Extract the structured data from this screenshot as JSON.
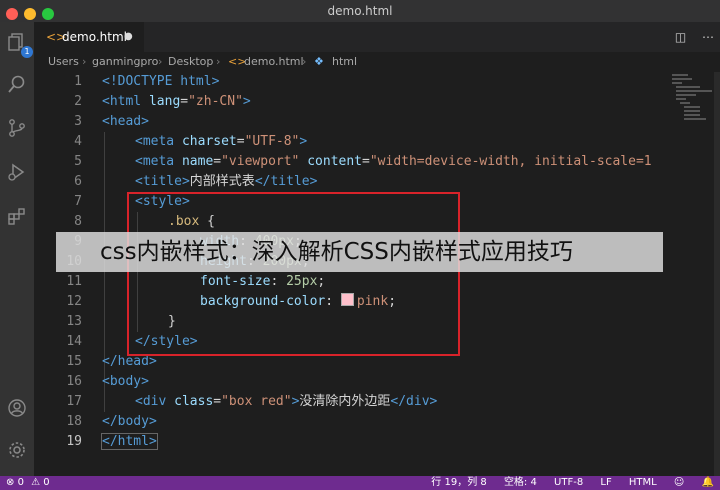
{
  "window": {
    "title": "demo.html"
  },
  "activity_bar": {
    "badge": "1"
  },
  "tab": {
    "label": "demo.html",
    "modified_dot": "●"
  },
  "breadcrumb": [
    "Users",
    "ganmingpro",
    "Desktop",
    "demo.html",
    "html"
  ],
  "editor": {
    "line_numbers": [
      "1",
      "2",
      "3",
      "4",
      "5",
      "6",
      "7",
      "8",
      "9",
      "10",
      "11",
      "12",
      "13",
      "14",
      "15",
      "16",
      "17",
      "18",
      "19"
    ],
    "lines": {
      "l1": {
        "a": "<!DOCTYPE html>"
      },
      "l2": {
        "a": "<html ",
        "b": "lang",
        "c": "=",
        "d": "\"zh-CN\"",
        "e": ">"
      },
      "l3": {
        "a": "<head>"
      },
      "l4": {
        "a": "<meta ",
        "b": "charset",
        "c": "=",
        "d": "\"UTF-8\"",
        "e": ">"
      },
      "l5": {
        "a": "<meta ",
        "b": "name",
        "c": "=",
        "d": "\"viewport\"",
        "e": " content",
        "f": "=",
        "g": "\"width=device-width, initial-scale=1"
      },
      "l6": {
        "a": "<title>",
        "b": "内部样式表",
        "c": "</title>"
      },
      "l7": {
        "a": "<style>"
      },
      "l8": {
        "a": ".box",
        "b": " {"
      },
      "l9": {
        "a": "width",
        "b": ": ",
        "c": "400px",
        "d": ";"
      },
      "l10": {
        "a": "height",
        "b": ": ",
        "c": "200px",
        "d": ";"
      },
      "l11": {
        "a": "font-size",
        "b": ": ",
        "c": "25px",
        "d": ";"
      },
      "l12": {
        "a": "background-color",
        "b": ": ",
        "c": "pink",
        "d": ";"
      },
      "l13": {
        "a": "}"
      },
      "l14": {
        "a": "</style>"
      },
      "l15": {
        "a": "</head>"
      },
      "l16": {
        "a": "<body>"
      },
      "l17": {
        "a": "<div ",
        "b": "class",
        "c": "=",
        "d": "\"box red\"",
        "e": ">",
        "f": "没清除内外边距",
        "g": "</div>"
      },
      "l18": {
        "a": "</body>"
      },
      "l19": {
        "a": "</html>"
      }
    }
  },
  "overlay_caption": "css内嵌样式：深入解析CSS内嵌样式应用技巧",
  "status_bar": {
    "errors": "0",
    "warnings": "0",
    "position": "行 19，列 8",
    "indent": "空格: 4",
    "encoding": "UTF-8",
    "eol": "LF",
    "language": "HTML"
  },
  "colors": {
    "status_bar": "#6e2b8f",
    "highlight_box": "#d8232a",
    "tag": "#569cd6"
  }
}
